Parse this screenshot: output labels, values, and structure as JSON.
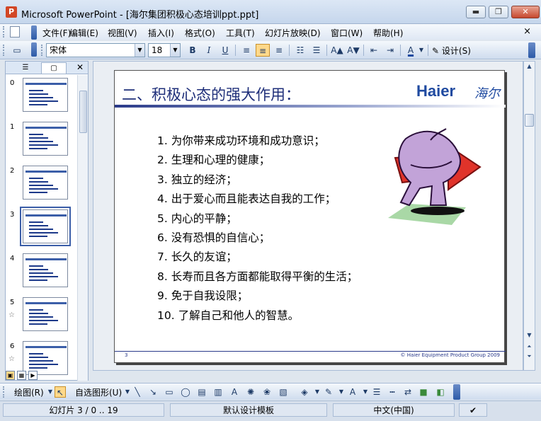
{
  "window": {
    "title": "Microsoft PowerPoint - [海尔集团积极心态培训ppt.ppt]",
    "minimize": "▬",
    "restore": "❐",
    "close": "✕"
  },
  "menu": {
    "items": [
      "文件(F)",
      "编辑(E)",
      "视图(V)",
      "插入(I)",
      "格式(O)",
      "工具(T)",
      "幻灯片放映(D)",
      "窗口(W)",
      "帮助(H)"
    ],
    "close_doc": "×"
  },
  "toolbar": {
    "font_name": "宋体",
    "font_size": "18",
    "bold": "B",
    "italic": "I",
    "underline": "U",
    "design": "设计(S)"
  },
  "thumbnails": [
    {
      "number": "0",
      "star": ""
    },
    {
      "number": "1",
      "star": ""
    },
    {
      "number": "2",
      "star": ""
    },
    {
      "number": "3",
      "star": ""
    },
    {
      "number": "4",
      "star": ""
    },
    {
      "number": "5",
      "star": "☆"
    },
    {
      "number": "6",
      "star": "☆"
    }
  ],
  "slide": {
    "title": "二、积极心态的强大作用：",
    "logo": "Haier",
    "logo_cn": "海尔",
    "points": [
      "1. 为你带来成功环境和成功意识；",
      "2. 生理和心理的健康；",
      "3. 独立的经济；",
      "4. 出于爱心而且能表达自我的工作；",
      "5. 内心的平静；",
      "6. 没有恐惧的自信心；",
      "7. 长久的友谊；",
      "8. 长寿而且各方面都能取得平衡的生活；",
      "9. 免于自我设限；",
      "10. 了解自己和他人的智慧。"
    ],
    "page_number": "3",
    "copyright": "© Haier Equipment Product Group 2009"
  },
  "drawbar": {
    "draw": "绘图(R)",
    "autoshapes": "自选图形(U)"
  },
  "status": {
    "slide_info": "幻灯片 3 / 0 .. 19",
    "template": "默认设计模板",
    "language": "中文(中国)"
  },
  "colors": {
    "title_blue": "#1f2f7a",
    "logo_blue": "#1f4aa0",
    "arrow_red": "#e0332a",
    "selection": "#ffd98a"
  }
}
